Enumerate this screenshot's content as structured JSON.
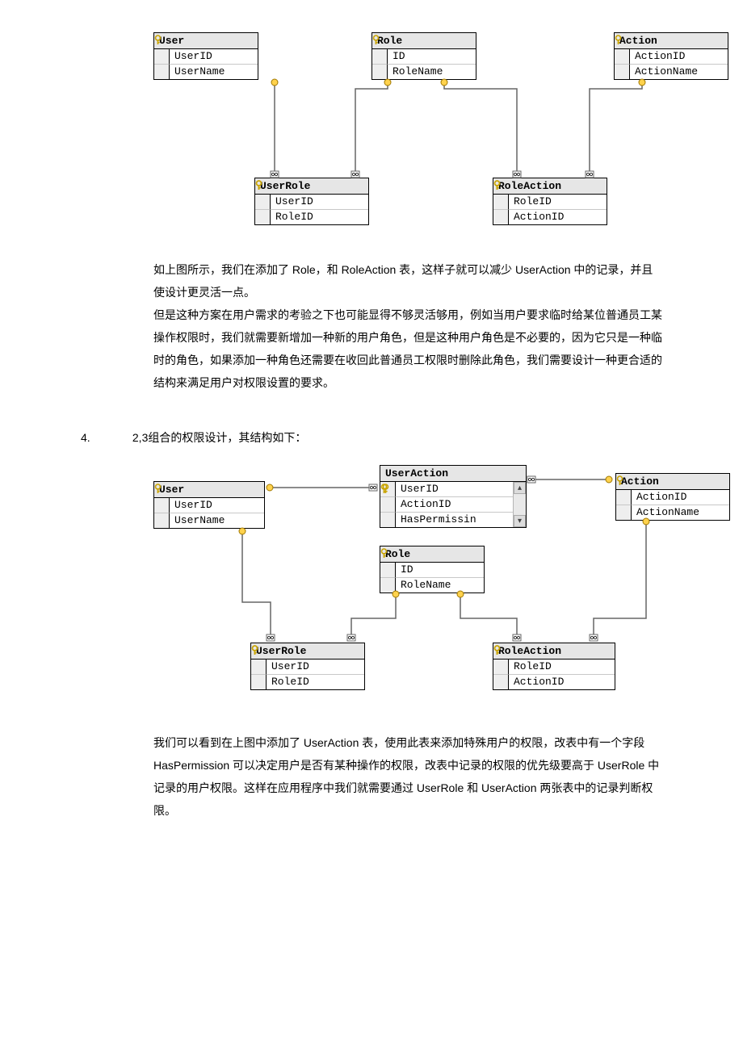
{
  "diagram1": {
    "tables": {
      "user": {
        "title": "User",
        "cols": [
          "UserID",
          "UserName"
        ],
        "keys": [
          true,
          false
        ]
      },
      "role": {
        "title": "Role",
        "cols": [
          "ID",
          "RoleName"
        ],
        "keys": [
          true,
          false
        ]
      },
      "action": {
        "title": "Action",
        "cols": [
          "ActionID",
          "ActionName"
        ],
        "keys": [
          true,
          false
        ]
      },
      "userRole": {
        "title": "UserRole",
        "cols": [
          "UserID",
          "RoleID"
        ],
        "keys": [
          true,
          true
        ]
      },
      "roleAction": {
        "title": "RoleAction",
        "cols": [
          "RoleID",
          "ActionID"
        ],
        "keys": [
          true,
          true
        ]
      }
    }
  },
  "para1": "如上图所示，我们在添加了 Role，和 RoleAction 表，这样子就可以减少 UserAction 中的记录，并且使设计更灵活一点。",
  "para2": "但是这种方案在用户需求的考验之下也可能显得不够灵活够用，例如当用户要求临时给某位普通员工某操作权限时，我们就需要新增加一种新的用户角色，但是这种用户角色是不必要的，因为它只是一种临时的角色，如果添加一种角色还需要在收回此普通员工权限时删除此角色，我们需要设计一种更合适的结构来满足用户对权限设置的要求。",
  "heading": {
    "num": "4.",
    "text": "2,3组合的权限设计，其结构如下："
  },
  "diagram2": {
    "tables": {
      "user": {
        "title": "User",
        "cols": [
          "UserID",
          "UserName"
        ],
        "keys": [
          true,
          false
        ]
      },
      "userAction": {
        "title": "UserAction",
        "cols": [
          "UserID",
          "ActionID",
          "HasPermissin"
        ],
        "keys": [
          true,
          true,
          false
        ]
      },
      "action": {
        "title": "Action",
        "cols": [
          "ActionID",
          "ActionName"
        ],
        "keys": [
          true,
          false
        ]
      },
      "role": {
        "title": "Role",
        "cols": [
          "ID",
          "RoleName"
        ],
        "keys": [
          true,
          false
        ]
      },
      "userRole": {
        "title": "UserRole",
        "cols": [
          "UserID",
          "RoleID"
        ],
        "keys": [
          true,
          true
        ]
      },
      "roleAction": {
        "title": "RoleAction",
        "cols": [
          "RoleID",
          "ActionID"
        ],
        "keys": [
          true,
          true
        ]
      }
    }
  },
  "para3": "我们可以看到在上图中添加了 UserAction 表，使用此表来添加特殊用户的权限，改表中有一个字段 HasPermission 可以决定用户是否有某种操作的权限，改表中记录的权限的优先级要高于 UserRole 中记录的用户权限。这样在应用程序中我们就需要通过 UserRole 和 UserAction 两张表中的记录判断权限。"
}
